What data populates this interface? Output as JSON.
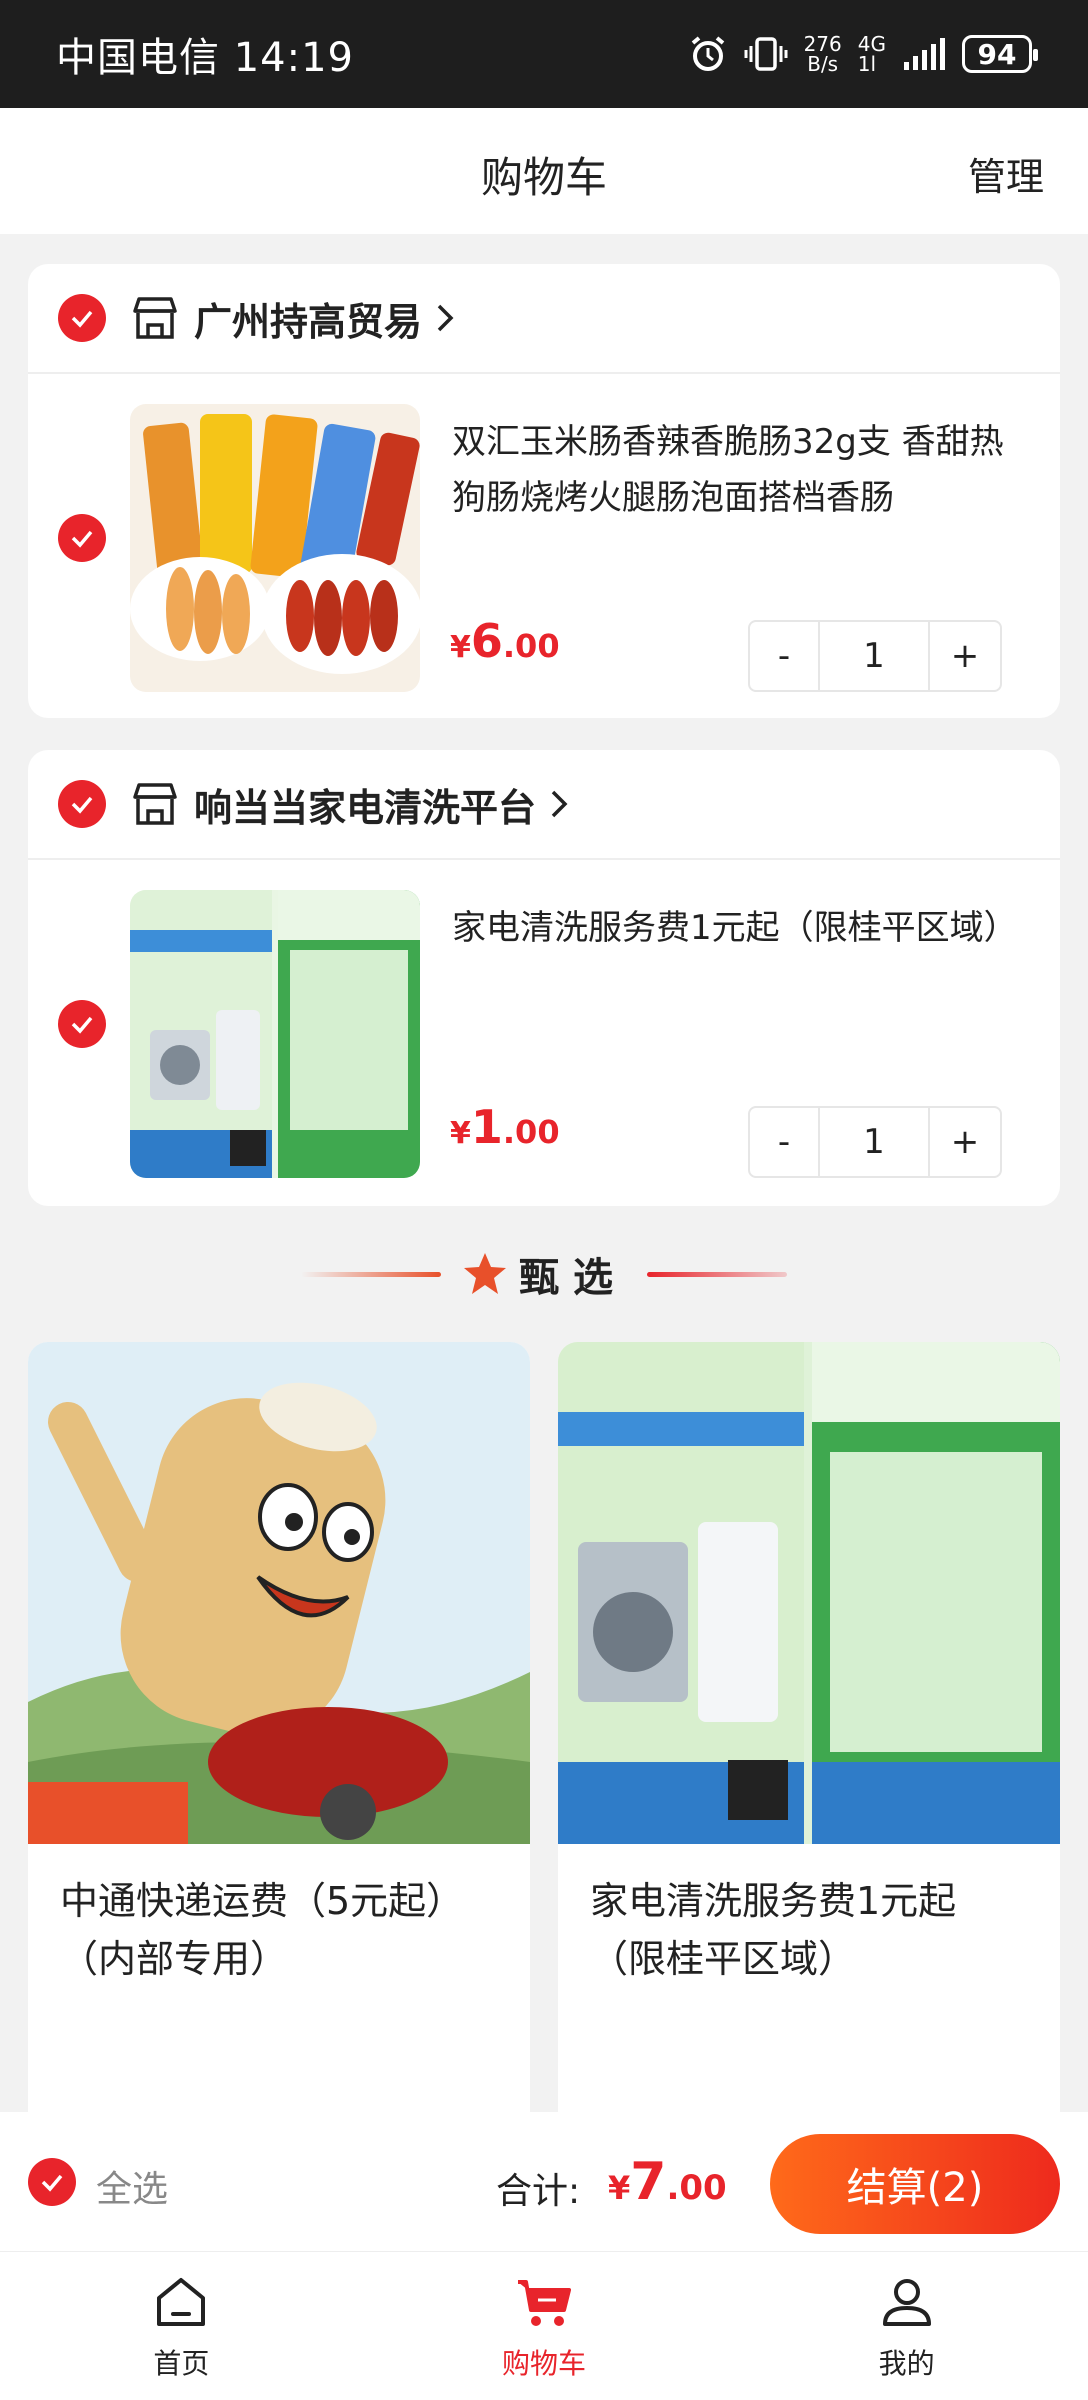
{
  "status_bar": {
    "carrier_time": "中国电信 14:19",
    "net_speed_value": "276",
    "net_speed_unit": "B/s",
    "network_type": "4G",
    "network_sub": "1l",
    "battery": "94"
  },
  "header": {
    "title": "购物车",
    "manage": "管理"
  },
  "shops": [
    {
      "name": "广州持高贸易",
      "item": {
        "title": "双汇玉米肠香辣香脆肠32g支 香甜热狗肠烧烤火腿肠泡面搭档香肠",
        "price_symbol": "¥",
        "price_int": "6",
        "price_dec": ".00",
        "qty": "1",
        "minus": "-",
        "plus": "+"
      }
    },
    {
      "name": "响当当家电清洗平台",
      "item": {
        "title": "家电清洗服务费1元起（限桂平区域）",
        "price_symbol": "¥",
        "price_int": "1",
        "price_dec": ".00",
        "qty": "1",
        "minus": "-",
        "plus": "+"
      }
    }
  ],
  "recommend": {
    "title": "甄选",
    "items": [
      {
        "title": "中通快递运费（5元起）（内部专用）"
      },
      {
        "title": "家电清洗服务费1元起（限桂平区域）"
      }
    ]
  },
  "checkout": {
    "select_all": "全选",
    "total_label": "合计:",
    "total_symbol": "¥",
    "total_int": "7",
    "total_dec": ".00",
    "button": "结算(2)"
  },
  "tabs": [
    {
      "label": "首页",
      "icon": "home-icon"
    },
    {
      "label": "购物车",
      "icon": "cart-icon",
      "active": true
    },
    {
      "label": "我的",
      "icon": "user-icon"
    }
  ],
  "colors": {
    "accent": "#e8242b",
    "checkout_gradient": [
      "#ff6a1a",
      "#ee2a1d"
    ]
  }
}
